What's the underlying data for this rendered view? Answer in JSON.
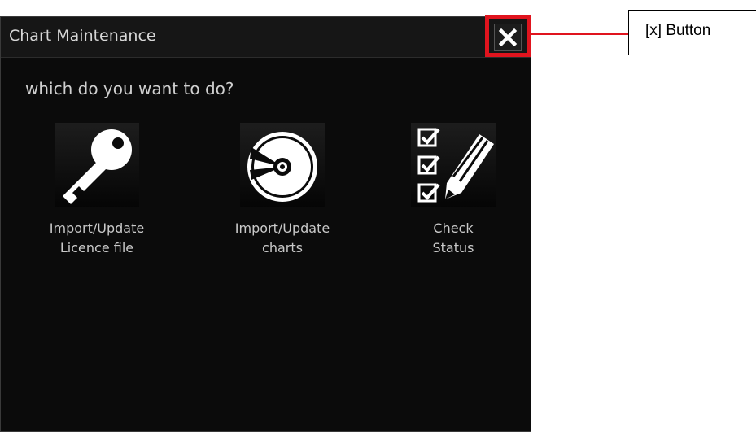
{
  "dialog": {
    "title": "Chart Maintenance",
    "prompt": "which do you want to do?",
    "close_icon": "close-icon"
  },
  "options": [
    {
      "icon": "key-icon",
      "label_line1": "Import/Update",
      "label_line2": "Licence file"
    },
    {
      "icon": "disc-icon",
      "label_line1": "Import/Update",
      "label_line2": "charts"
    },
    {
      "icon": "checklist-pencil-icon",
      "label_line1": "Check",
      "label_line2": "Status"
    }
  ],
  "annotation": {
    "callout_text": "[x] Button",
    "highlight_color": "#e0141e"
  }
}
